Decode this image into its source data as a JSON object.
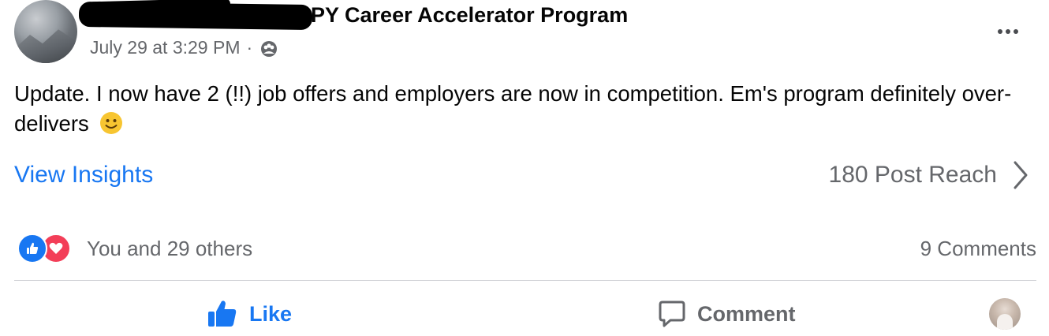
{
  "post": {
    "group_name": "PY Career Accelerator Program",
    "timestamp": "July 29 at 3:29 PM",
    "separator": "·",
    "text": "Update. I now have 2 (!!) job offers and employers are now in competition. Em's program definitely over-delivers"
  },
  "insights": {
    "view_label": "View Insights",
    "reach": "180 Post Reach"
  },
  "engagement": {
    "reactions_text": "You and 29 others",
    "comments": "9 Comments"
  },
  "actions": {
    "like": "Like",
    "comment": "Comment"
  },
  "icons": {
    "privacy": "group-privacy-icon",
    "more": "more-options-icon",
    "chevron": "chevron-right-icon",
    "like_reaction": "like-reaction-icon",
    "love_reaction": "love-reaction-icon",
    "like_action": "thumbs-up-icon",
    "comment_action": "comment-bubble-icon",
    "emoji": "smiley-emoji-icon"
  },
  "colors": {
    "accent": "#1877f2",
    "secondary_text": "#65676b",
    "love": "#f33e58",
    "divider": "#ced0d4"
  }
}
